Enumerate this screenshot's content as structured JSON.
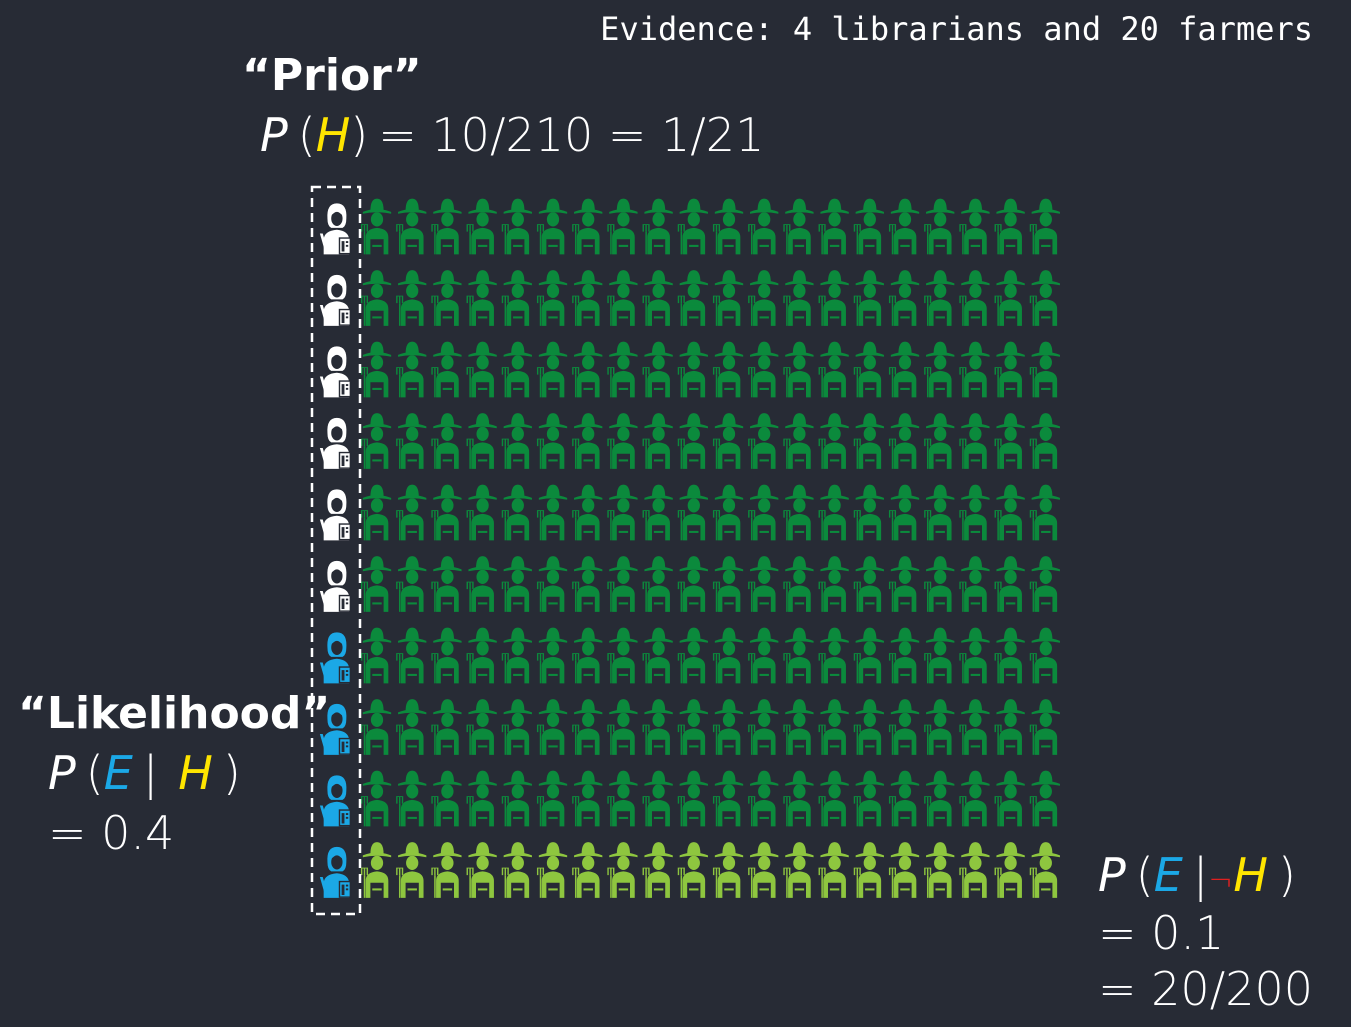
{
  "evidence": "Evidence: 4 librarians and 20 farmers",
  "prior": {
    "title": "“Prior”",
    "P": "P",
    "H": "H",
    "open": "(",
    "close": ")",
    "rest": "= 10/210 = 1/21"
  },
  "likelihood": {
    "title": "“Likelihood”",
    "P": "P",
    "E": "E",
    "bar": "|",
    "H": "H",
    "open": "(",
    "close": ")",
    "value": "= 0.4"
  },
  "likelihood_not": {
    "P": "P",
    "E": "E",
    "bar": "|",
    "neg": "¬",
    "H": "H",
    "open": "(",
    "close": ")",
    "value1": "= 0.1",
    "value2": "= 20/200"
  },
  "grid": {
    "rows": 10,
    "farmer_columns": 20,
    "librarians_total": 10,
    "librarians_matching_evidence": 4,
    "farmer_rows_matching_evidence": 1,
    "colors": {
      "librarian": "#ffffff",
      "librarian_evidence": "#1ba8e6",
      "farmer": "#0b8a3c",
      "farmer_evidence": "#8ec63f",
      "highlight_border": "#ffffff"
    }
  }
}
